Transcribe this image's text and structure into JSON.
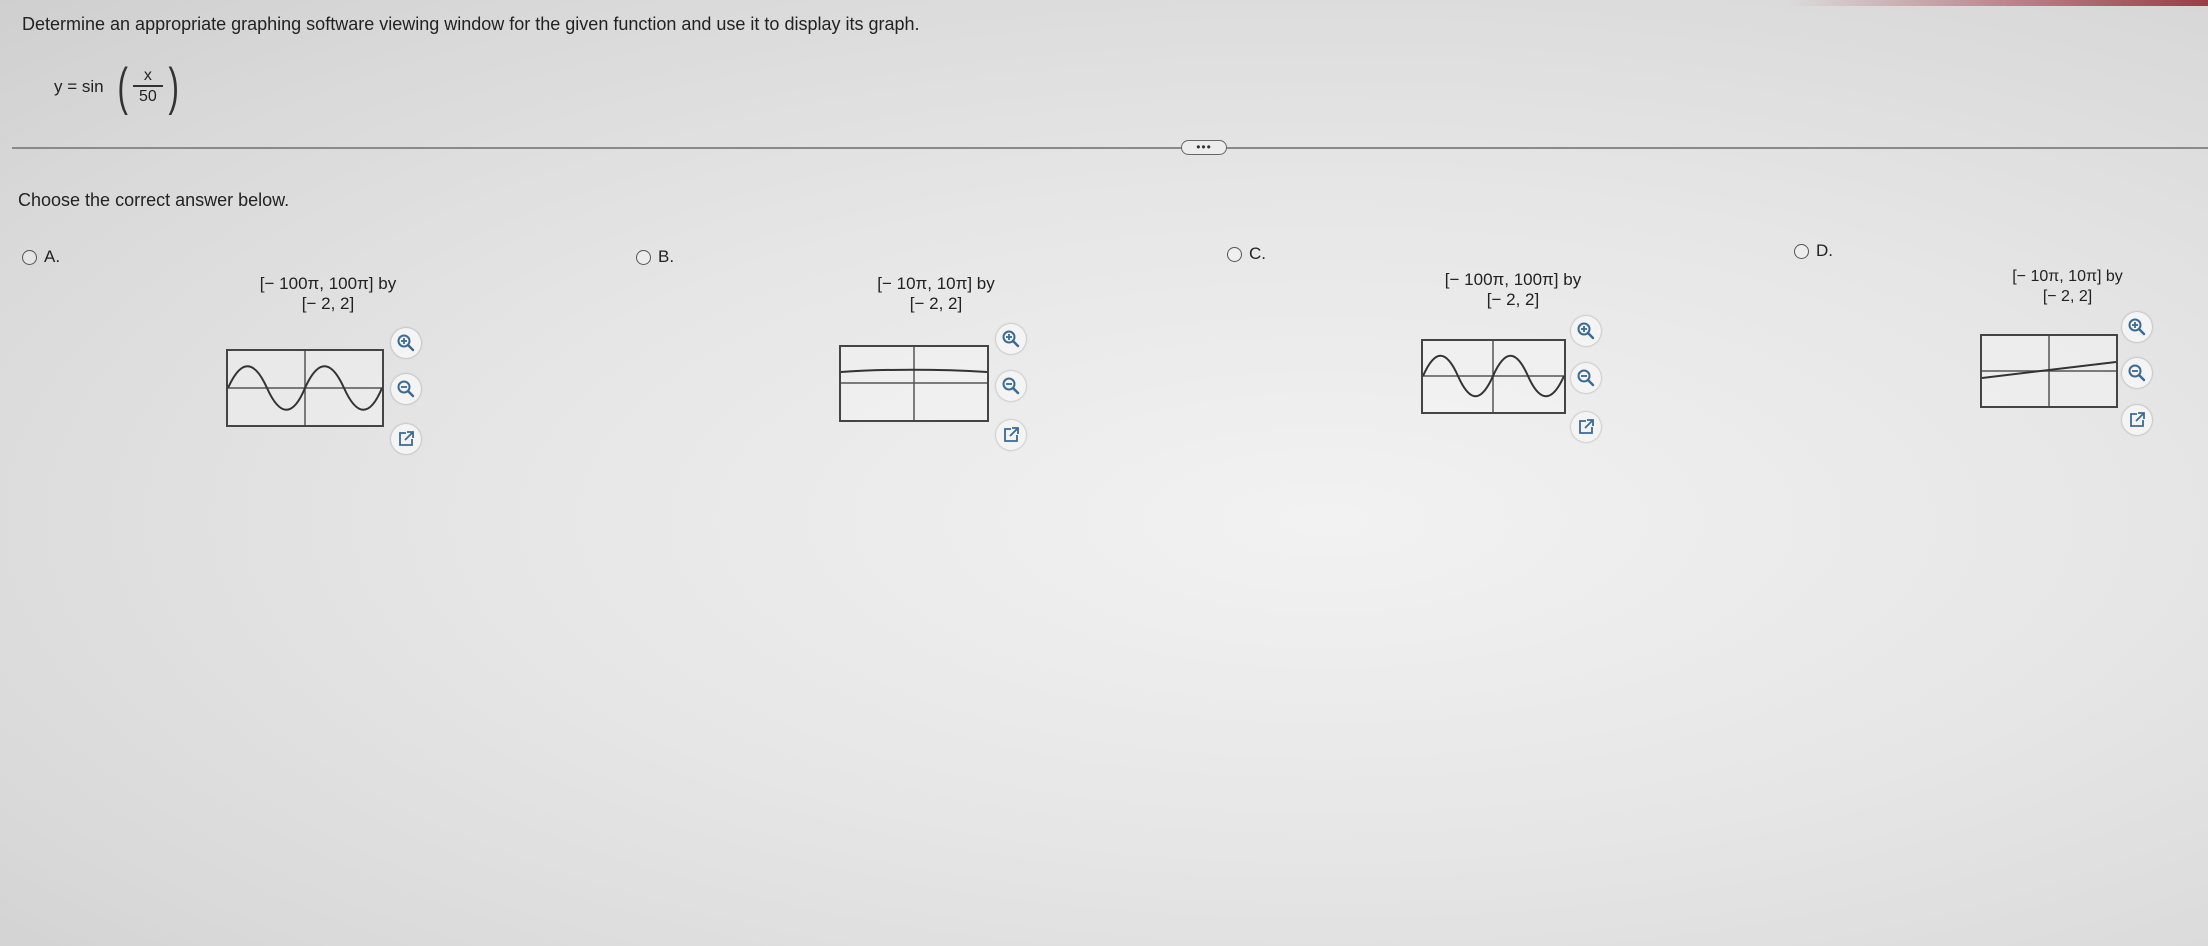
{
  "question": {
    "instruction": "Determine an appropriate graphing software viewing window for the given function and use it to display its graph.",
    "equation": {
      "lhs": "y = sin",
      "numerator": "x",
      "denominator": "50"
    }
  },
  "prompt": "Choose the correct answer below.",
  "more_button": "•••",
  "options": [
    {
      "letter": "A.",
      "window_line1": "[− 100π, 100π] by",
      "window_line2": "[− 2, 2]",
      "graph": "sine-wave"
    },
    {
      "letter": "B.",
      "window_line1": "[− 10π, 10π] by",
      "window_line2": "[− 2, 2]",
      "graph": "near-flat-line"
    },
    {
      "letter": "C.",
      "window_line1": "[− 100π, 100π] by",
      "window_line2": "[− 2, 2]",
      "graph": "sine-wave"
    },
    {
      "letter": "D.",
      "window_line1": "[− 10π, 10π] by",
      "window_line2": "[− 2, 2]",
      "graph": "rising-line"
    }
  ],
  "icons": {
    "zoom_in": "zoom-in-icon",
    "zoom_out": "zoom-out-icon",
    "open": "open-external-icon"
  },
  "colors": {
    "accent": "#9c3b46",
    "icon": "#3a6a96"
  }
}
